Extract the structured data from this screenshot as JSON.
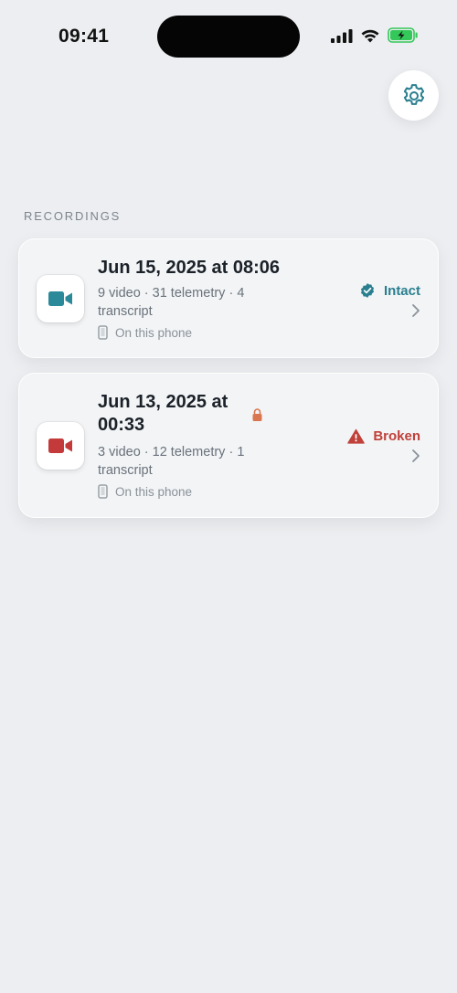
{
  "status_bar": {
    "time": "09:41"
  },
  "section": {
    "label": "RECORDINGS"
  },
  "recordings": [
    {
      "title": "Jun 15, 2025 at 08:06",
      "meta": "9 video · 31 telemetry · 4 transcript",
      "location": "On this phone",
      "status": "Intact",
      "status_color": "#2a7f8f",
      "icon": "video-camera-icon",
      "icon_color": "#2a8a9a",
      "locked": false
    },
    {
      "title": "Jun 13, 2025 at 00:33",
      "meta": "3 video · 12 telemetry · 1 transcript",
      "location": "On this phone",
      "status": "Broken",
      "status_color": "#c0413a",
      "icon": "video-camera-icon",
      "icon_color": "#c43a3a",
      "locked": true
    }
  ],
  "colors": {
    "background": "#eceef1",
    "card": "#f2f4f6",
    "accent": "#2a7f8f",
    "error": "#c0413a"
  }
}
